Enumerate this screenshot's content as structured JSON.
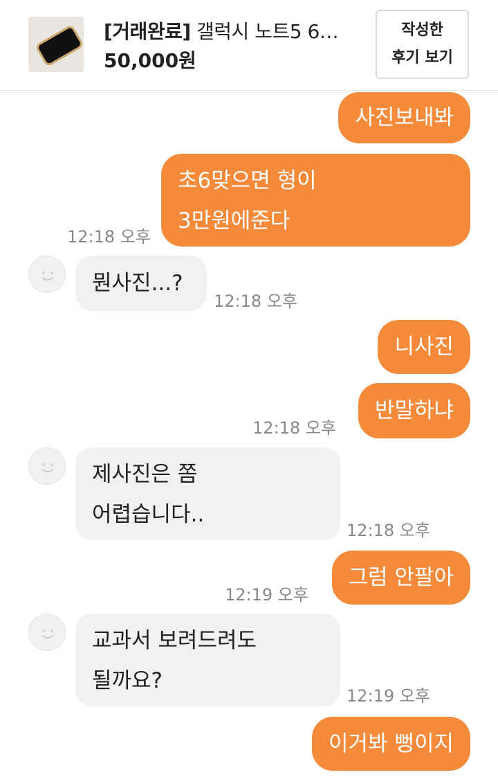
{
  "header": {
    "product_status": "[거래완료]",
    "product_name": " 갤럭시 노트5 6…",
    "price": "50,000원",
    "review_button_line1": "작성한",
    "review_button_line2": "후기 보기"
  },
  "messages": [
    {
      "side": "out",
      "lines": [
        "사진보내봐"
      ]
    },
    {
      "side": "out",
      "lines": [
        "초6맞으면 형이",
        "3만원에준다"
      ],
      "time": "12:18 오후"
    },
    {
      "side": "in",
      "lines": [
        "뭔사진...?"
      ],
      "time": "12:18 오후"
    },
    {
      "side": "out",
      "lines": [
        "니사진"
      ]
    },
    {
      "side": "out",
      "lines": [
        "반말하냐"
      ],
      "time": "12:18 오후"
    },
    {
      "side": "in",
      "lines": [
        "제사진은 쫌",
        "어렵습니다.."
      ],
      "time": "12:18 오후"
    },
    {
      "side": "out",
      "lines": [
        "그럼 안팔아"
      ],
      "time": "12:19 오후"
    },
    {
      "side": "in",
      "lines": [
        "교과서 보려드려도",
        "될까요?"
      ],
      "time": "12:19 오후"
    },
    {
      "side": "out",
      "lines": [
        "이거봐 뻥이지"
      ]
    }
  ]
}
